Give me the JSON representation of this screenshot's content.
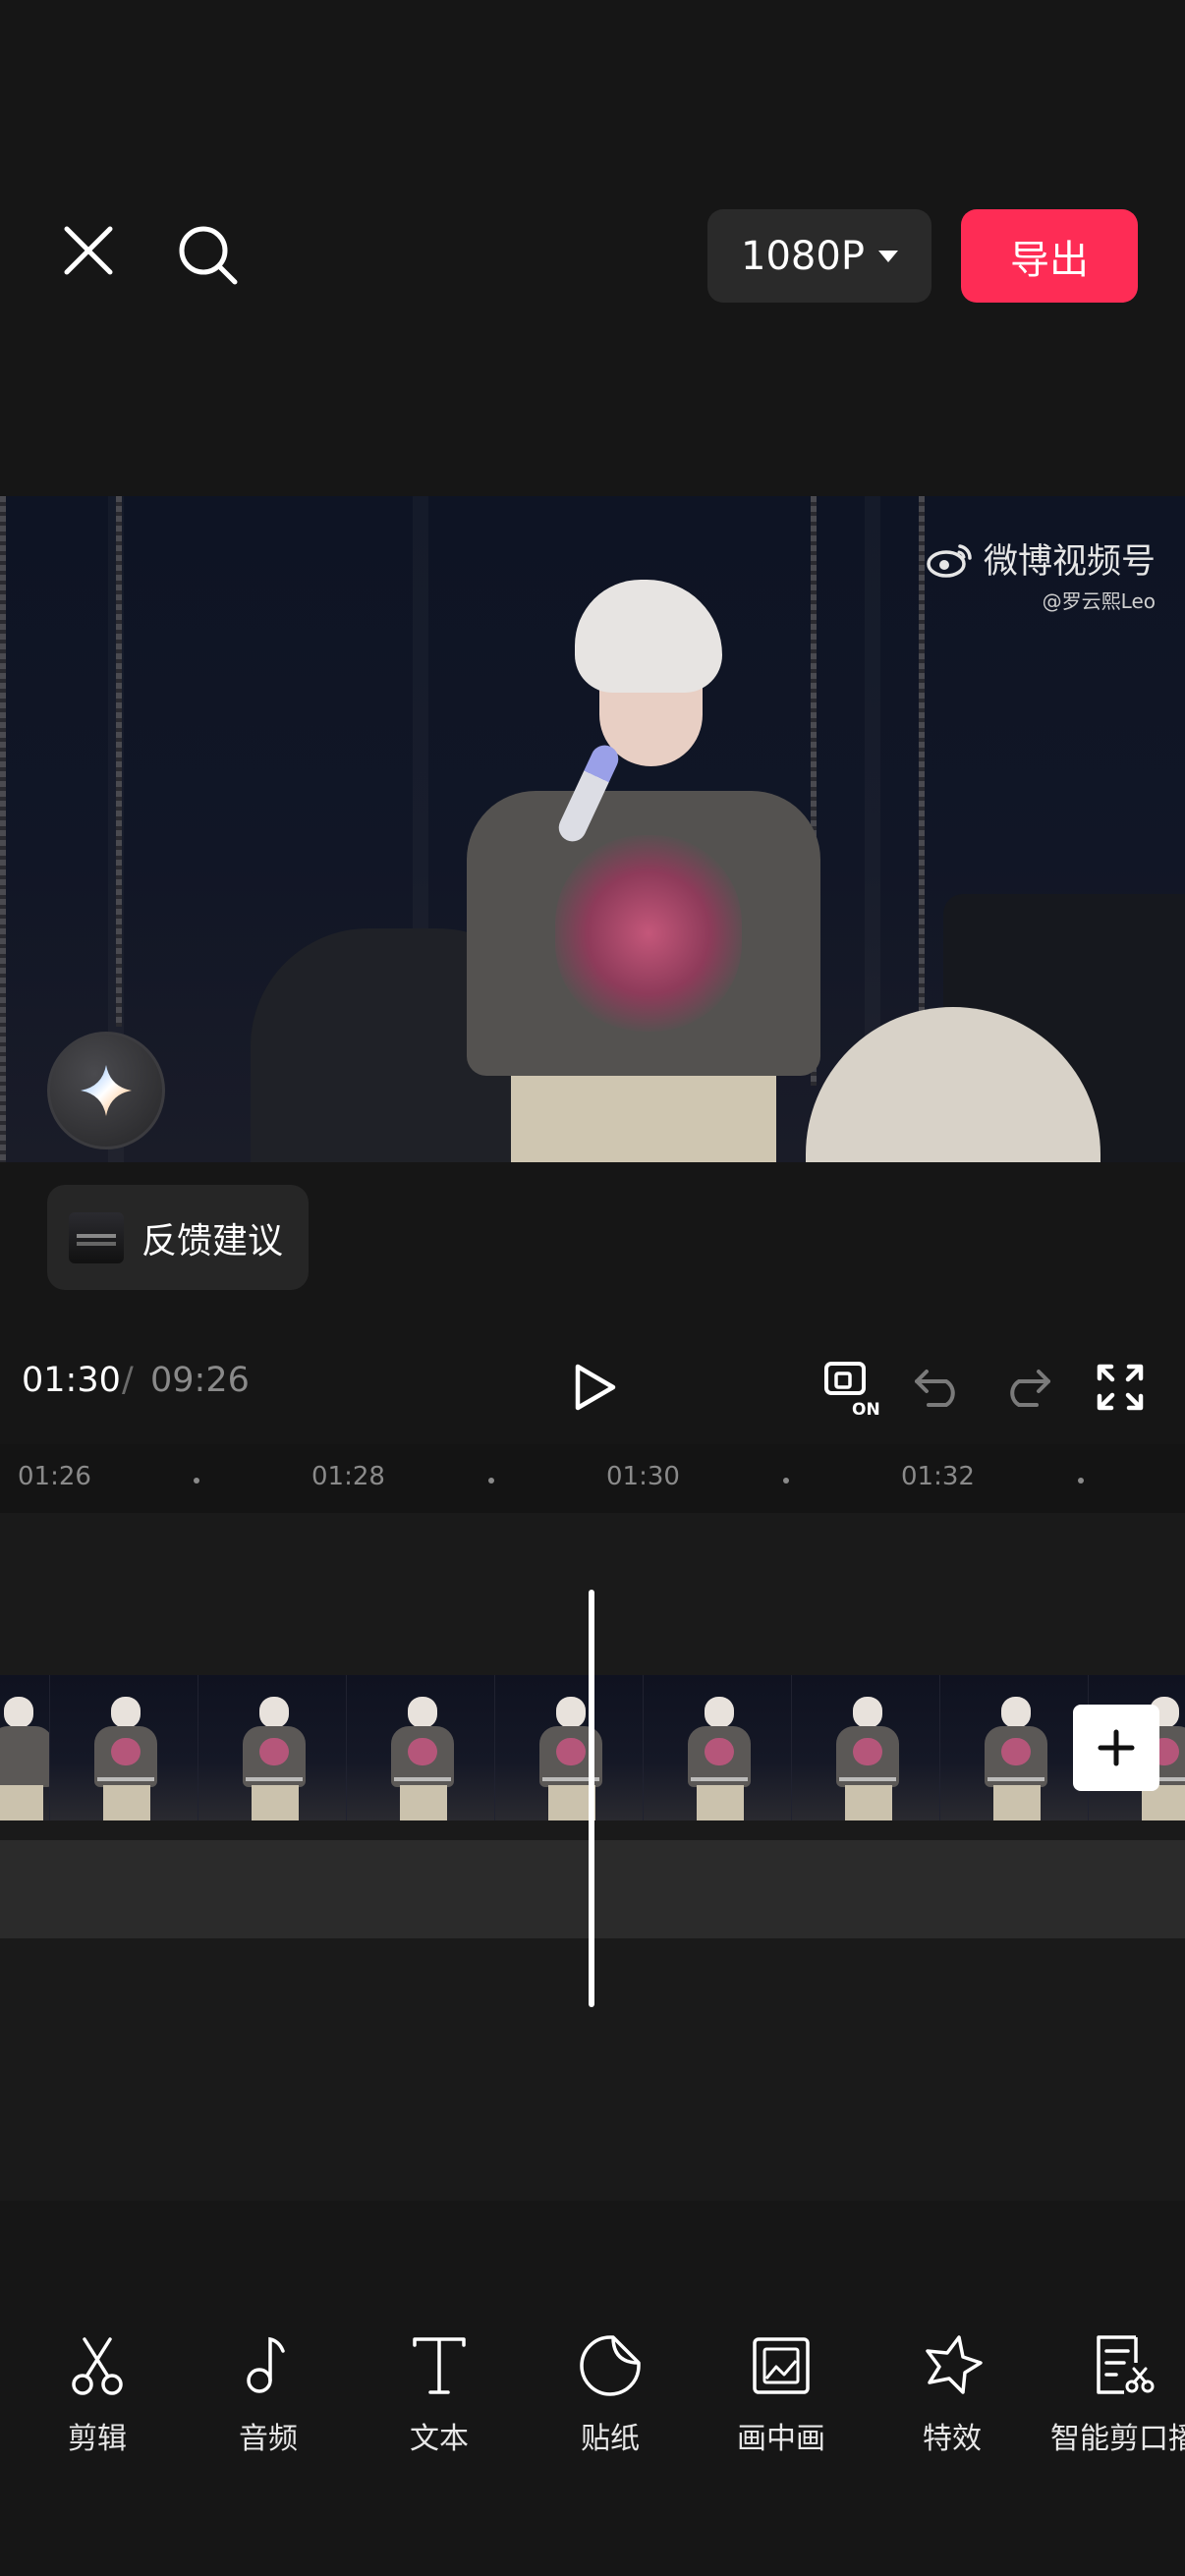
{
  "header": {
    "resolution": "1080P",
    "export_label": "导出"
  },
  "preview": {
    "watermark_main": "微博视频号",
    "watermark_sub": "@罗云熙Leo"
  },
  "feedback": {
    "label": "反馈建议"
  },
  "playback": {
    "current_time": "01:30",
    "separator": "/",
    "total_time": "09:26",
    "enhance_badge": "ON"
  },
  "timeline": {
    "ticks": [
      "01:26",
      "01:28",
      "01:30",
      "01:32"
    ]
  },
  "toolbar": {
    "items": [
      {
        "label": "剪辑",
        "icon": "scissors-icon"
      },
      {
        "label": "音频",
        "icon": "music-note-icon"
      },
      {
        "label": "文本",
        "icon": "text-icon"
      },
      {
        "label": "贴纸",
        "icon": "sticker-icon"
      },
      {
        "label": "画中画",
        "icon": "picture-in-picture-icon"
      },
      {
        "label": "特效",
        "icon": "effects-star-icon"
      },
      {
        "label": "智能剪口播",
        "icon": "smart-cut-icon"
      }
    ]
  },
  "colors": {
    "accent": "#fe2c55",
    "background": "#161616"
  }
}
